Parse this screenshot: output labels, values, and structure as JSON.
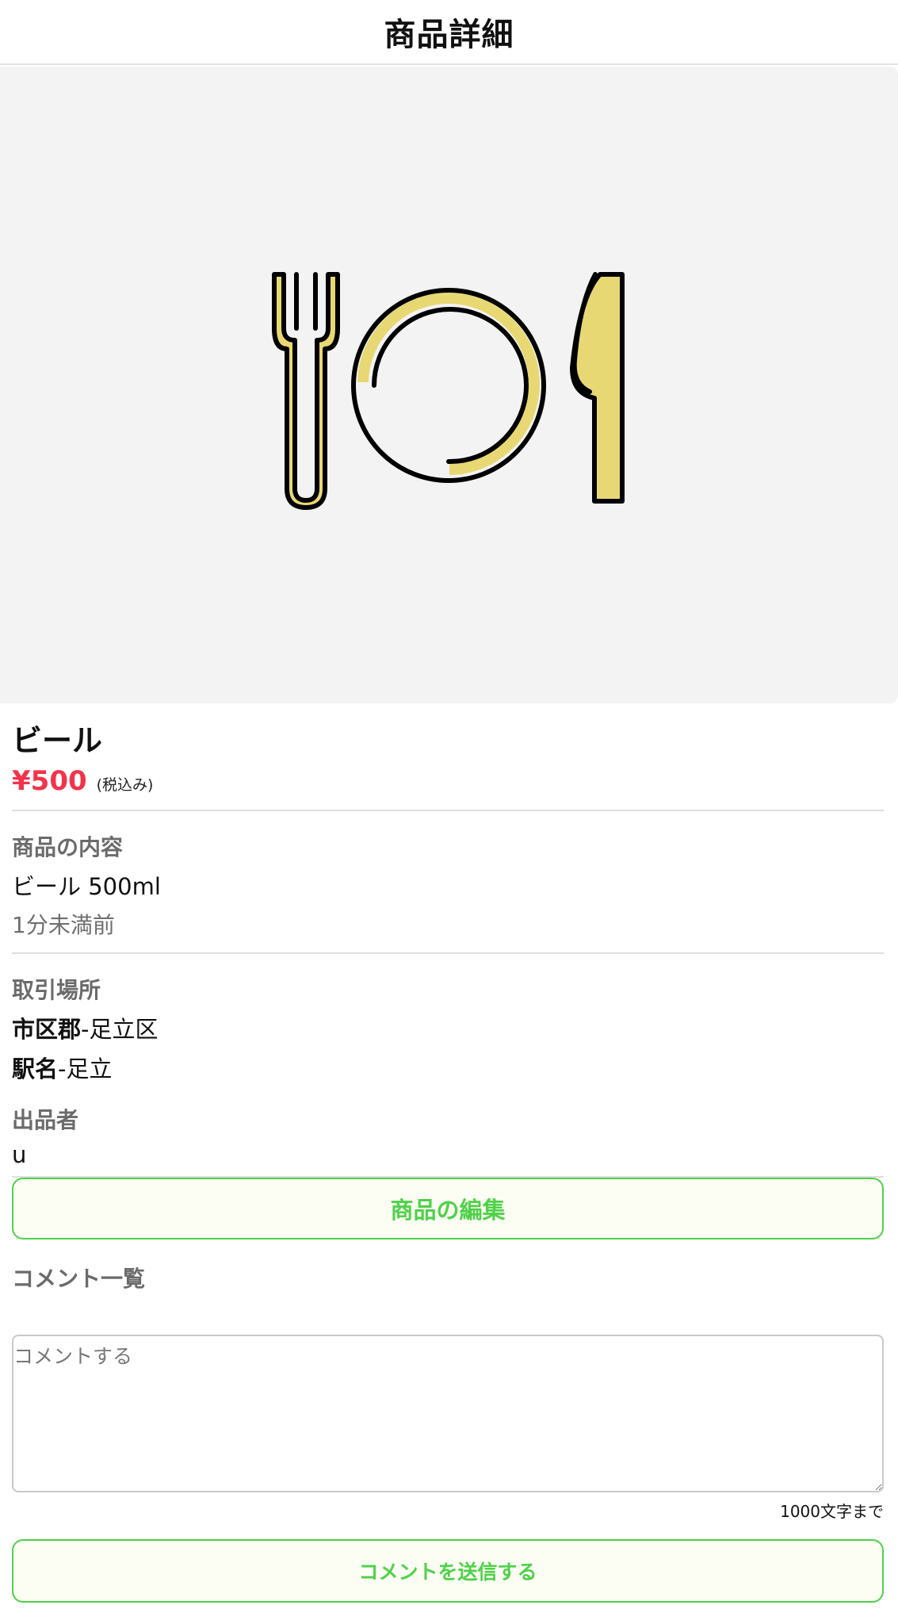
{
  "header": {
    "title": "商品詳細"
  },
  "product": {
    "image_icon": "dinner-plate-fork-knife-icon",
    "name": "ビール",
    "price": "¥500",
    "tax_note": "(税込み)",
    "content_label": "商品の内容",
    "content": "ビール 500ml",
    "posted": "1分未満前"
  },
  "location": {
    "label": "取引場所",
    "city_key": "市区郡",
    "city_value": "-足立区",
    "station_key": "駅名",
    "station_value": "-足立"
  },
  "seller": {
    "label": "出品者",
    "name": "u"
  },
  "actions": {
    "edit_label": "商品の編集"
  },
  "comments": {
    "label": "コメント一覧",
    "placeholder": "コメントする",
    "limit_note": "1000文字まで",
    "submit_label": "コメントを送信する"
  },
  "colors": {
    "price": "#f2344b",
    "accent_green": "#4fd14a",
    "illustration_yellow": "#e8d873",
    "image_background": "#f3f3f3"
  }
}
